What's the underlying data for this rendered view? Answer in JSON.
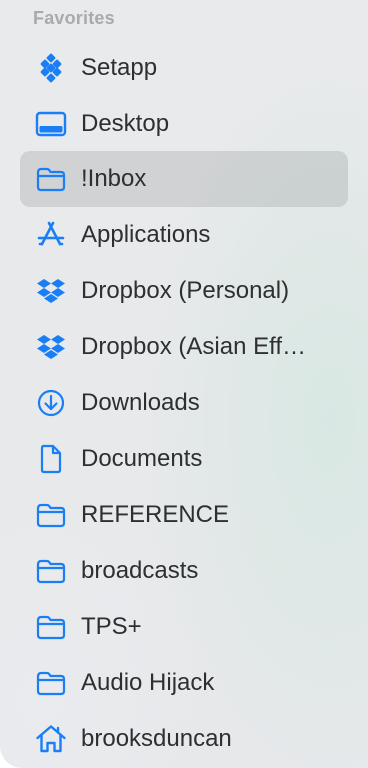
{
  "sidebar": {
    "section_title": "Favorites",
    "accent_color": "#1a7ef5",
    "items": [
      {
        "label": "Setapp",
        "icon": "setapp-icon",
        "selected": false
      },
      {
        "label": "Desktop",
        "icon": "desktop-icon",
        "selected": false
      },
      {
        "label": "!Inbox",
        "icon": "folder-icon",
        "selected": true
      },
      {
        "label": "Applications",
        "icon": "applications-icon",
        "selected": false
      },
      {
        "label": "Dropbox (Personal)",
        "icon": "dropbox-icon",
        "selected": false
      },
      {
        "label": "Dropbox (Asian Eff…",
        "icon": "dropbox-icon",
        "selected": false
      },
      {
        "label": "Downloads",
        "icon": "downloads-icon",
        "selected": false
      },
      {
        "label": "Documents",
        "icon": "document-icon",
        "selected": false
      },
      {
        "label": "REFERENCE",
        "icon": "folder-icon",
        "selected": false
      },
      {
        "label": "broadcasts",
        "icon": "folder-icon",
        "selected": false
      },
      {
        "label": "TPS+",
        "icon": "folder-icon",
        "selected": false
      },
      {
        "label": "Audio Hijack",
        "icon": "folder-icon",
        "selected": false
      },
      {
        "label": "brooksduncan",
        "icon": "home-icon",
        "selected": false
      }
    ]
  }
}
